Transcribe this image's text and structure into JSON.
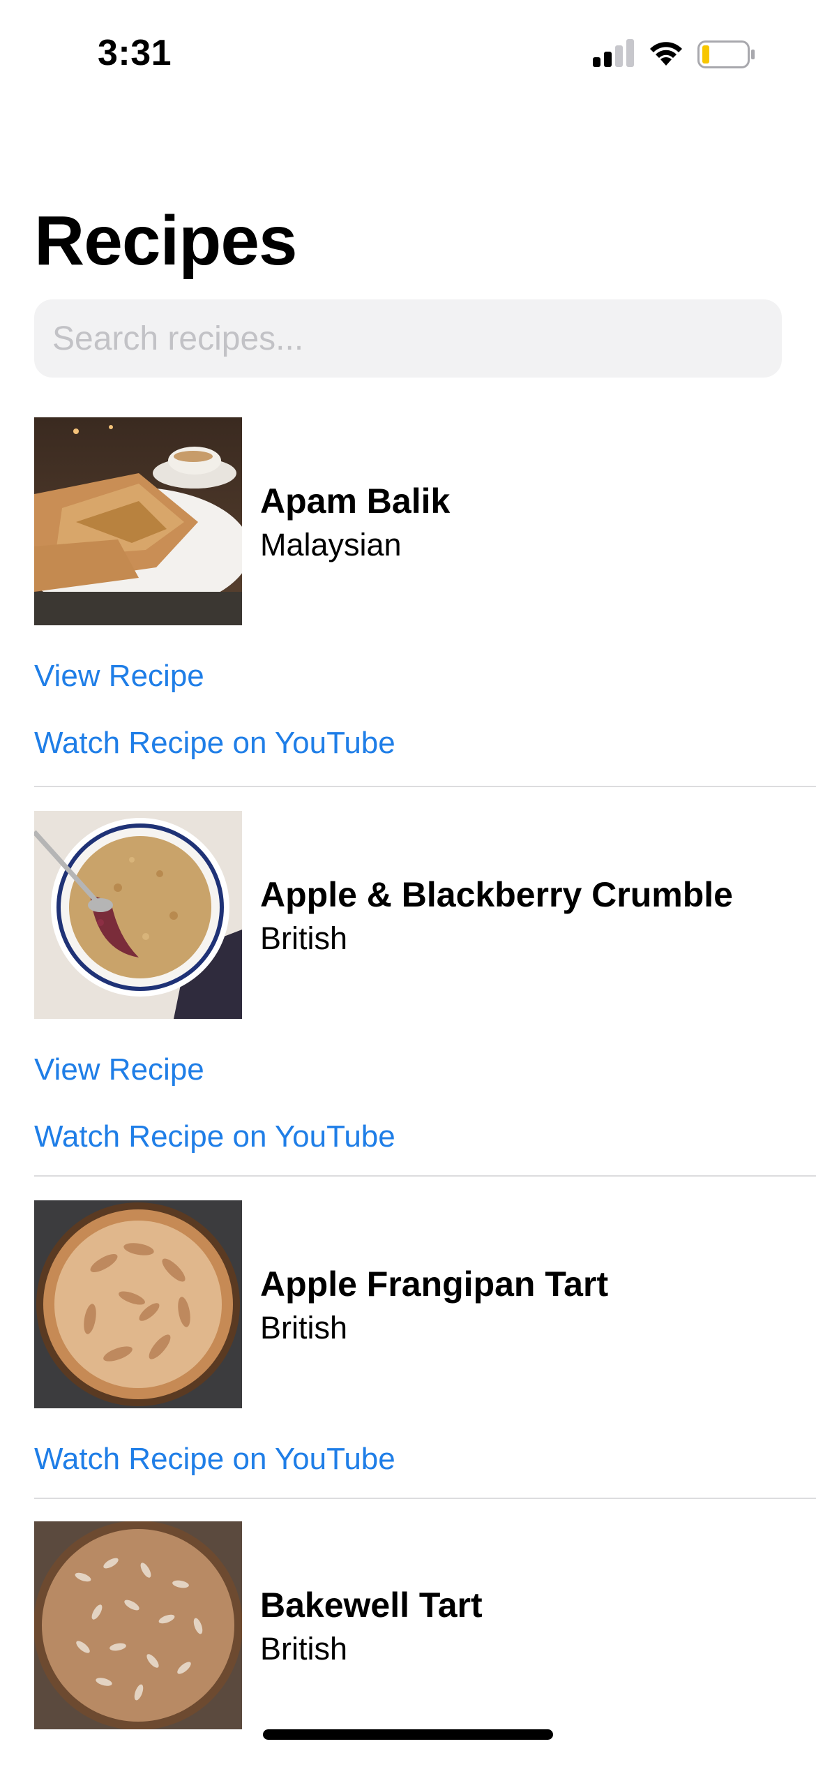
{
  "status_bar": {
    "time": "3:31"
  },
  "header": {
    "title": "Recipes"
  },
  "search": {
    "placeholder": "Search recipes..."
  },
  "recipes": [
    {
      "name": "Apam Balik",
      "cuisine": "Malaysian",
      "view_label": "View Recipe",
      "youtube_label": "Watch Recipe on YouTube"
    },
    {
      "name": "Apple & Blackberry Crumble",
      "cuisine": "British",
      "view_label": "View Recipe",
      "youtube_label": "Watch Recipe on YouTube"
    },
    {
      "name": "Apple Frangipan Tart",
      "cuisine": "British",
      "youtube_label": "Watch Recipe on YouTube"
    },
    {
      "name": "Bakewell Tart",
      "cuisine": "British"
    }
  ],
  "colors": {
    "link": "#1f7ee7",
    "search_bg": "#f2f2f3",
    "separator": "#dcdcde"
  }
}
